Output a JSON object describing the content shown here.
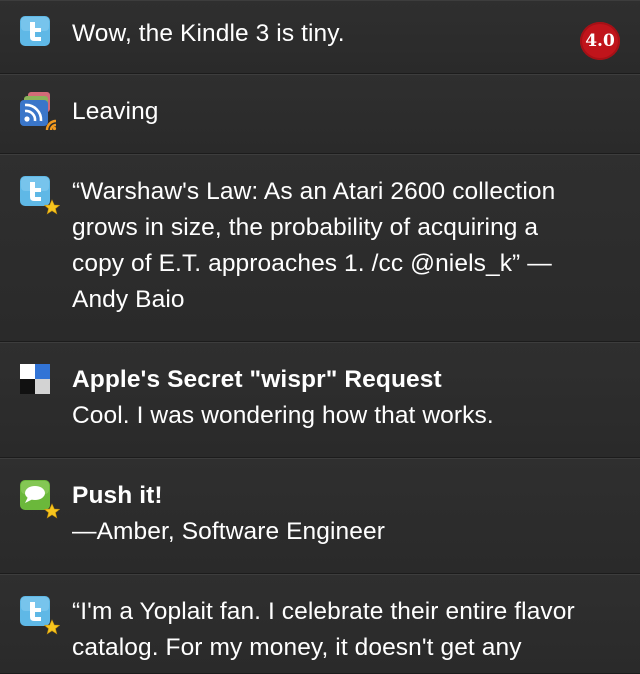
{
  "badge": {
    "value": "4.0"
  },
  "items": [
    {
      "source": "twitter",
      "icon": "twitter-icon",
      "favorite": false,
      "lines": [
        "Wow, the Kindle 3 is tiny."
      ]
    },
    {
      "source": "rss",
      "icon": "rss-feed-icon",
      "favorite": false,
      "lines": [
        "Leaving"
      ]
    },
    {
      "source": "twitter",
      "icon": "twitter-icon",
      "favorite": true,
      "lines": [
        "“Warshaw's Law: As an Atari 2600 collection",
        "grows in size, the probability of acquiring a",
        "copy of E.T. approaches 1. /cc @niels_k” —",
        "Andy Baio"
      ]
    },
    {
      "source": "delicious",
      "icon": "delicious-icon",
      "favorite": false,
      "title": "Apple's Secret \"wispr\" Request",
      "lines": [
        "Cool. I was wondering how that works."
      ]
    },
    {
      "source": "chat",
      "icon": "speech-bubble-icon",
      "favorite": true,
      "title": "Push it!",
      "lines": [
        "—Amber, Software Engineer"
      ]
    },
    {
      "source": "twitter",
      "icon": "twitter-icon",
      "favorite": true,
      "lines": [
        "“I'm a Yoplait fan. I celebrate their entire flavor",
        "catalog. For my money, it doesn't get any"
      ]
    }
  ]
}
